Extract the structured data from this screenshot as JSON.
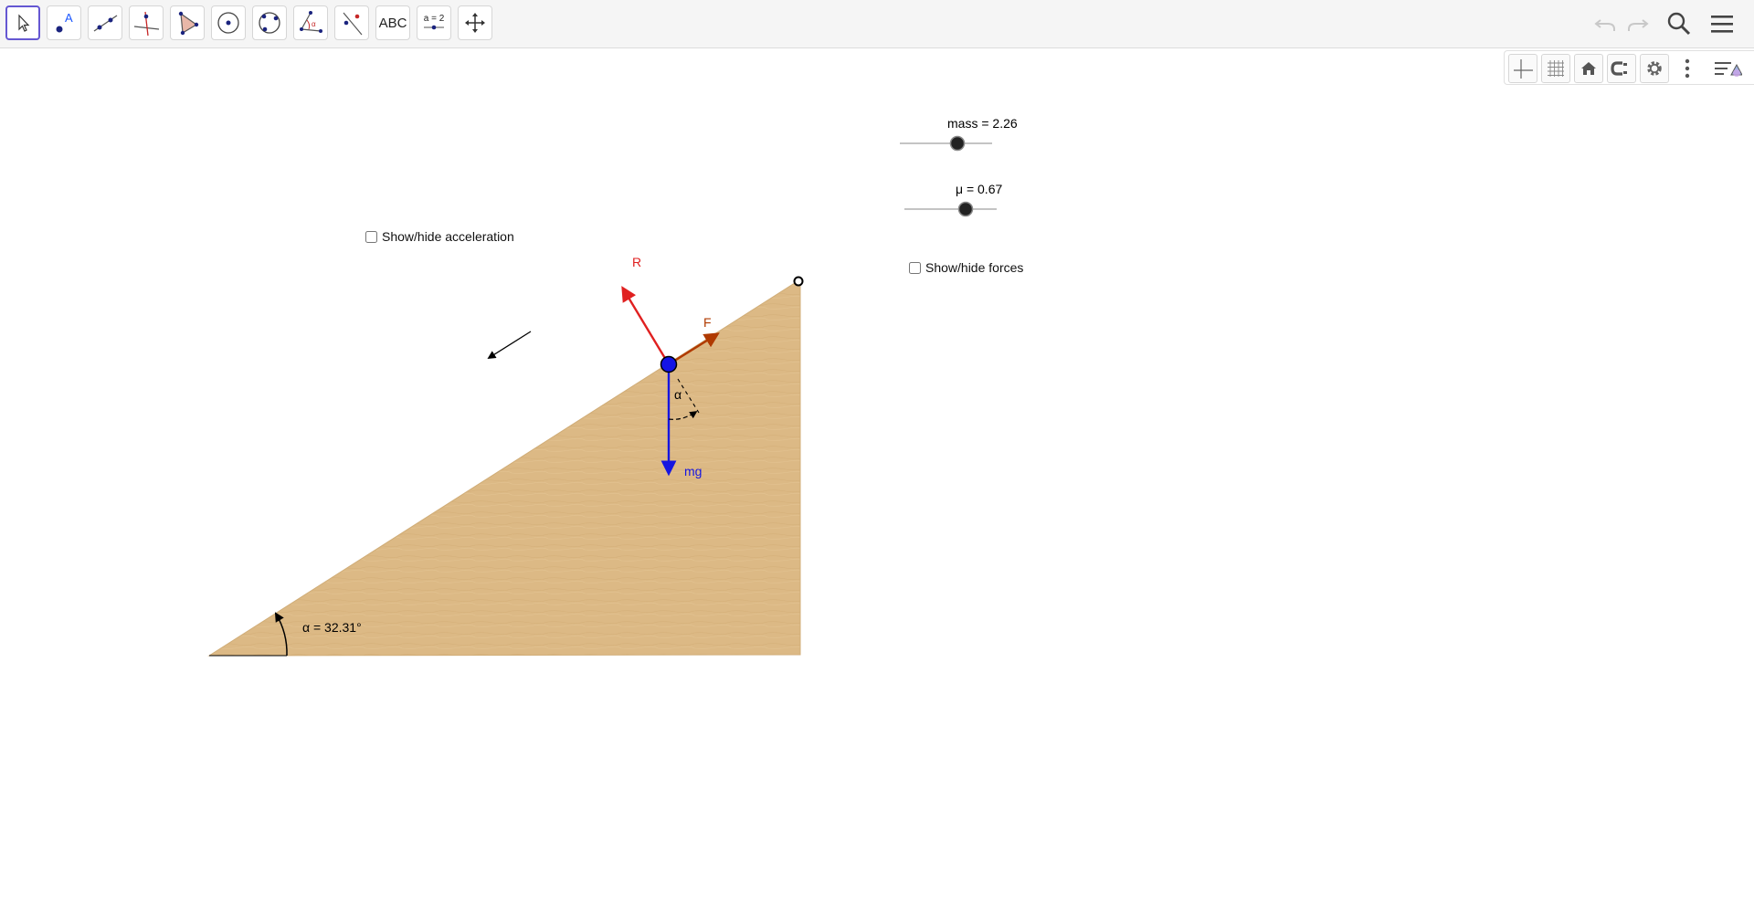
{
  "toolbar": {
    "tools": [
      {
        "name": "move-tool",
        "icon": "pointer-arrow-icon"
      },
      {
        "name": "point-tool",
        "icon": "point-icon"
      },
      {
        "name": "line-tool",
        "icon": "line-icon"
      },
      {
        "name": "perpendicular-tool",
        "icon": "perpendicular-line-icon"
      },
      {
        "name": "polygon-tool",
        "icon": "polygon-icon"
      },
      {
        "name": "circle-tool",
        "icon": "circle-center-point-icon"
      },
      {
        "name": "ellipse-tool",
        "icon": "circle-three-points-icon"
      },
      {
        "name": "angle-tool",
        "icon": "angle-icon"
      },
      {
        "name": "reflect-tool",
        "icon": "reflect-about-line-icon"
      },
      {
        "name": "text-tool",
        "icon": "text-icon",
        "label": "ABC"
      },
      {
        "name": "slider-tool",
        "icon": "slider-icon",
        "label": "a = 2"
      },
      {
        "name": "move-graphics-tool",
        "icon": "move-graphics-view-icon"
      }
    ],
    "right": [
      "undo-icon",
      "redo-icon",
      "search-icon",
      "menu-icon"
    ]
  },
  "stylebar": [
    "axes-icon",
    "grid-icon",
    "home-icon",
    "point-capturing-icon",
    "gear-icon",
    "more-vertical-icon",
    "style-bar-toggle-icon"
  ],
  "sliders": {
    "mass": {
      "label": "mass = 2.26",
      "value": 2.26
    },
    "mu": {
      "label": "μ = 0.67",
      "value": 0.67
    }
  },
  "checkboxes": {
    "acceleration": {
      "label": "Show/hide acceleration",
      "checked": false
    },
    "forces": {
      "label": "Show/hide forces",
      "checked": false
    }
  },
  "figure": {
    "angle_label": "α = 32.31°",
    "inner_angle_label": "α",
    "force_labels": {
      "R": "R",
      "F": "F",
      "mg": "mg"
    },
    "colors": {
      "wood": "#dcb985",
      "reaction": "#e02020",
      "friction": "#b03a00",
      "weight": "#1515e0",
      "block": "#1414e6"
    }
  }
}
